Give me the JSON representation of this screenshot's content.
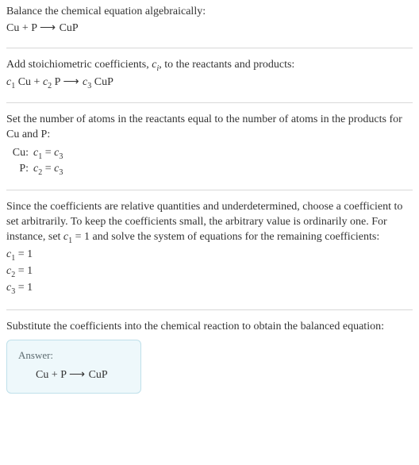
{
  "section1": {
    "title": "Balance the chemical equation algebraically:",
    "equation_lhs": "Cu + P",
    "arrow": "⟶",
    "equation_rhs": "CuP"
  },
  "section2": {
    "intro_a": "Add stoichiometric coefficients, ",
    "intro_ci": "c",
    "intro_ci_sub": "i",
    "intro_b": ", to the reactants and products:",
    "c1": "c",
    "c1s": "1",
    "sp1": " Cu + ",
    "c2": "c",
    "c2s": "2",
    "sp2": " P ",
    "arrow": "⟶",
    "c3": " c",
    "c3s": "3",
    "sp3": " CuP"
  },
  "section3": {
    "intro": "Set the number of atoms in the reactants equal to the number of atoms in the products for Cu and P:",
    "rows": [
      {
        "label": "Cu:",
        "lhs_c": "c",
        "lhs_s": "1",
        "eq": " = ",
        "rhs_c": "c",
        "rhs_s": "3"
      },
      {
        "label": "P:",
        "lhs_c": "c",
        "lhs_s": "2",
        "eq": " = ",
        "rhs_c": "c",
        "rhs_s": "3"
      }
    ]
  },
  "section4": {
    "para_a": "Since the coefficients are relative quantities and underdetermined, choose a coefficient to set arbitrarily. To keep the coefficients small, the arbitrary value is ordinarily one. For instance, set ",
    "cvar": "c",
    "csub": "1",
    "para_b": " = 1 and solve the system of equations for the remaining coefficients:",
    "coefs": [
      {
        "c": "c",
        "s": "1",
        "val": " = 1"
      },
      {
        "c": "c",
        "s": "2",
        "val": " = 1"
      },
      {
        "c": "c",
        "s": "3",
        "val": " = 1"
      }
    ]
  },
  "section5": {
    "intro": "Substitute the coefficients into the chemical reaction to obtain the balanced equation:",
    "answer_label": "Answer:",
    "eq_lhs": "Cu + P",
    "arrow": "⟶",
    "eq_rhs": "CuP"
  }
}
